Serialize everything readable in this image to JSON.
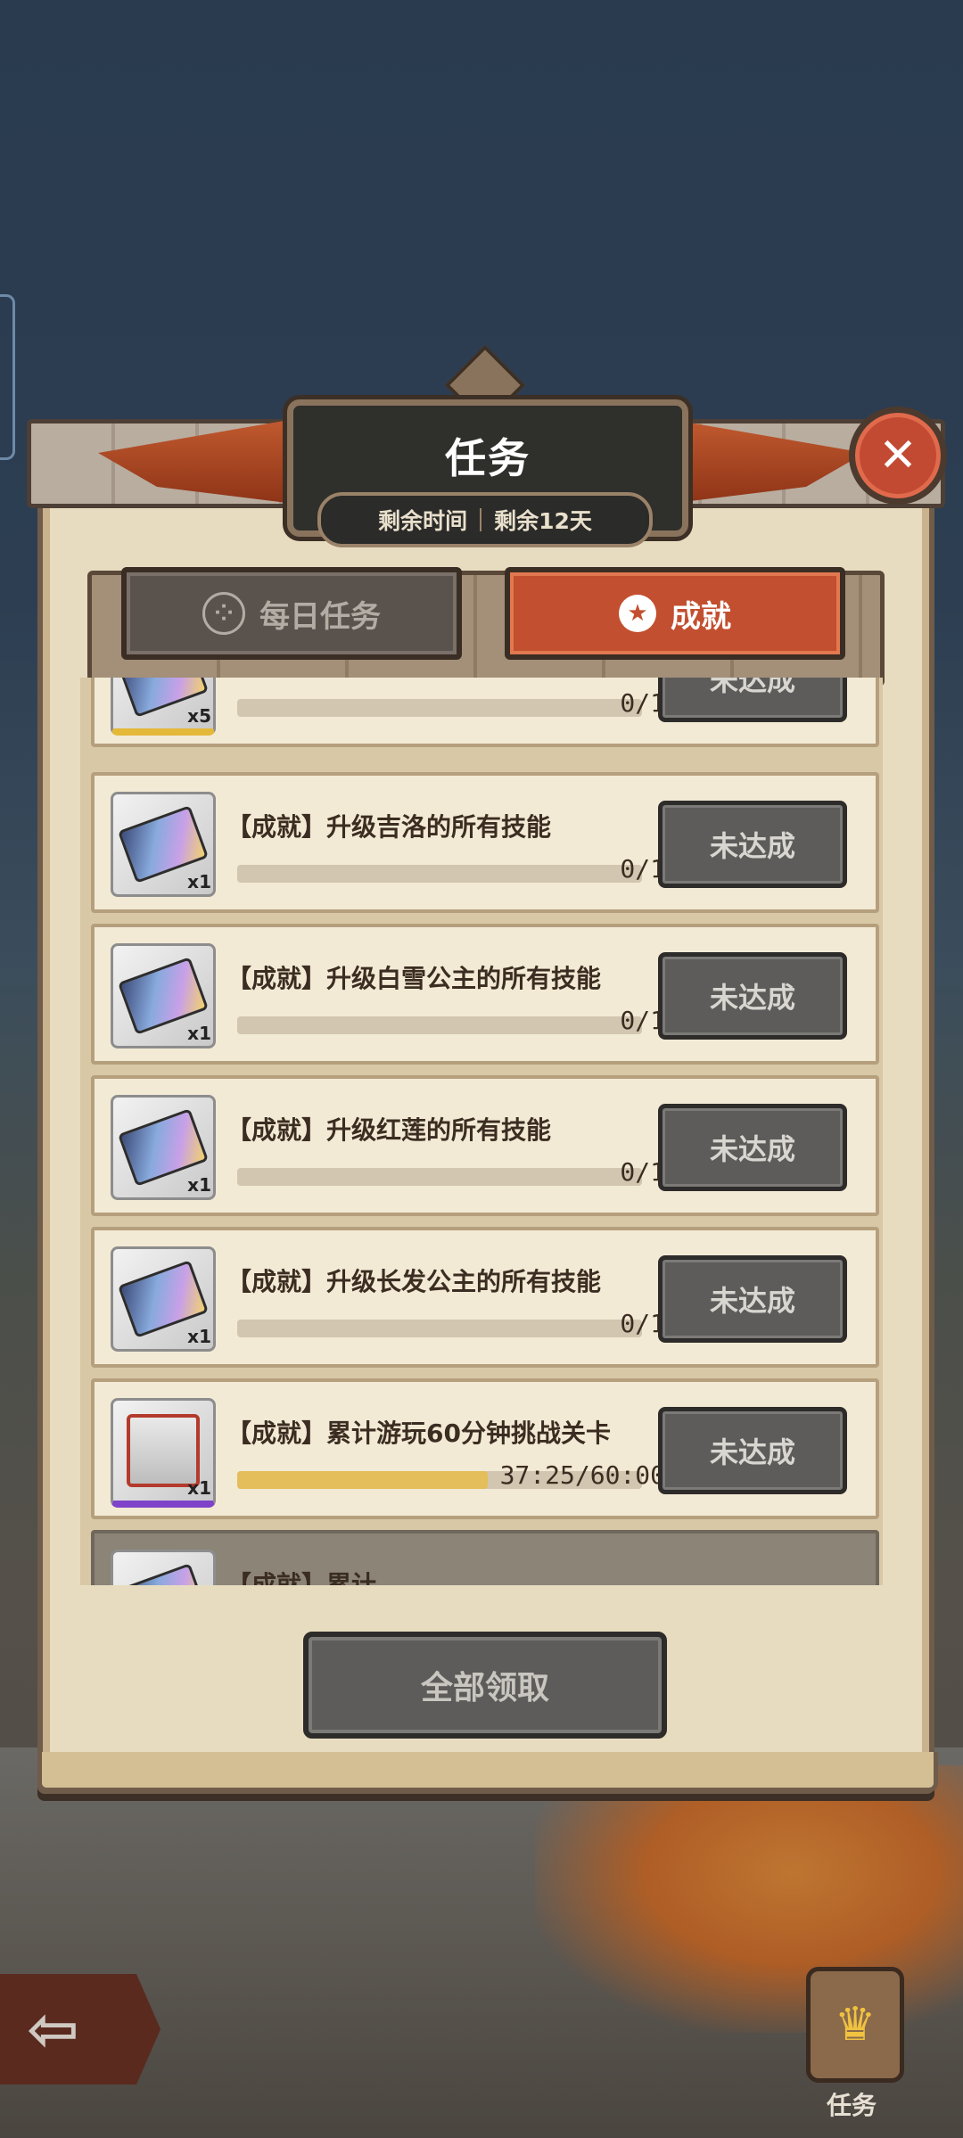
{
  "header": {
    "title": "任务",
    "time_label": "剩余时间",
    "time_value": "剩余12天"
  },
  "tabs": [
    {
      "label": "每日任务",
      "icon": "dots-circle-icon",
      "active": false
    },
    {
      "label": "成就",
      "icon": "star-icon",
      "active": true
    }
  ],
  "achievements": [
    {
      "title": "",
      "progress_text": "0/1",
      "progress": 0,
      "status": "未达成",
      "reward_icon": "ticket-icon",
      "qty": "x5",
      "rarity_color": "#e4b93a"
    },
    {
      "title": "【成就】升级吉洛的所有技能",
      "progress_text": "0/1",
      "progress": 0,
      "status": "未达成",
      "reward_icon": "ticket-icon",
      "qty": "x1",
      "rarity_color": "#8d8d8d"
    },
    {
      "title": "【成就】升级白雪公主的所有技能",
      "progress_text": "0/1",
      "progress": 0,
      "status": "未达成",
      "reward_icon": "ticket-icon",
      "qty": "x1",
      "rarity_color": "#8d8d8d"
    },
    {
      "title": "【成就】升级红莲的所有技能",
      "progress_text": "0/1",
      "progress": 0,
      "status": "未达成",
      "reward_icon": "ticket-icon",
      "qty": "x1",
      "rarity_color": "#8d8d8d"
    },
    {
      "title": "【成就】升级长发公主的所有技能",
      "progress_text": "0/1",
      "progress": 0,
      "status": "未达成",
      "reward_icon": "ticket-icon",
      "qty": "x1",
      "rarity_color": "#8d8d8d"
    },
    {
      "title": "【成就】累计游玩60分钟挑战关卡",
      "progress_text": "37:25/60:00",
      "progress": 0.62,
      "status": "未达成",
      "reward_icon": "chest-icon",
      "qty": "x1",
      "rarity_color": "#7e43c9"
    },
    {
      "title": "【成就】累计",
      "progress_text": "",
      "progress": 0,
      "status": "",
      "reward_icon": "ticket-icon",
      "qty": "",
      "rarity_color": "#8d8d8d"
    }
  ],
  "claim_all_label": "全部领取",
  "bottom_nav": {
    "quest_label": "任务",
    "back_icon": "arrow-left-icon",
    "quest_icon": "crown-scroll-icon"
  },
  "colors": {
    "accent_tab": "#c24f2f",
    "disabled_button": "#5e5c5a",
    "progress_fill": "#e3be5a",
    "panel_bg": "#e8dcc0"
  }
}
